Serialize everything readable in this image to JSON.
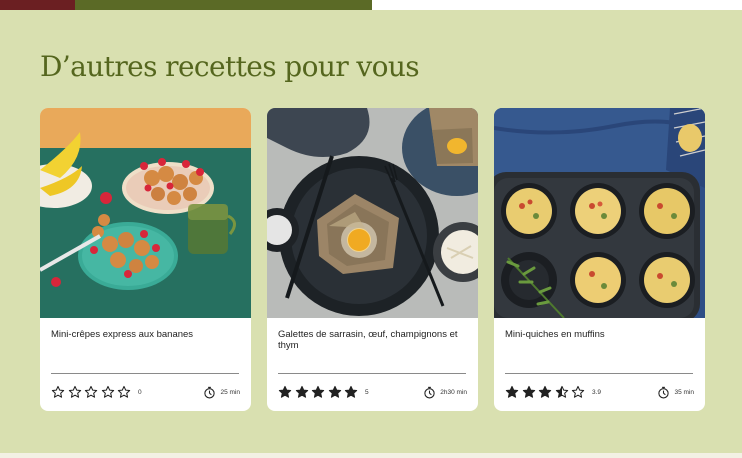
{
  "section": {
    "heading": "D’autres recettes pour vous"
  },
  "cards": [
    {
      "title": "Mini-crêpes express aux bananes",
      "rating": 0,
      "rating_count": "0",
      "time": "25 min"
    },
    {
      "title": "Galettes de sarrasin, œuf, champignons et thym",
      "rating": 5,
      "rating_count": "5",
      "time": "2h30 min"
    },
    {
      "title": "Mini-quiches en muffins",
      "rating": 3.5,
      "rating_count": "3.9",
      "time": "35 min"
    }
  ],
  "colors": {
    "panel": "#d9e0b0",
    "heading": "#55661e",
    "card": "#ffffff",
    "star": "#222222"
  },
  "icons": {
    "star": "star-icon",
    "timer": "timer-icon"
  }
}
